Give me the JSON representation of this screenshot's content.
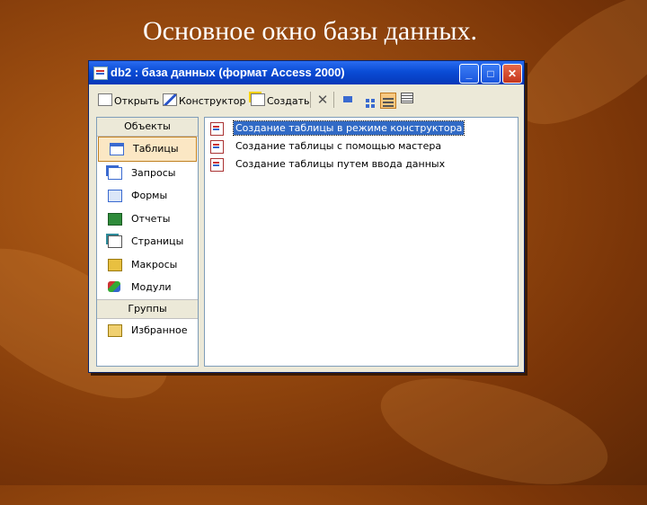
{
  "slide": {
    "title": "Основное окно базы данных."
  },
  "window": {
    "title": "db2 : база данных (формат Access 2000)",
    "controls": {
      "minimize": "_",
      "maximize": "□",
      "close": "✕"
    }
  },
  "toolbar": {
    "open": "Открыть",
    "design": "Конструктор",
    "create": "Создать"
  },
  "left_panel": {
    "objects_header": "Объекты",
    "items": [
      {
        "label": "Таблицы",
        "icon": "table-icon",
        "active": true
      },
      {
        "label": "Запросы",
        "icon": "query-icon"
      },
      {
        "label": "Формы",
        "icon": "form-icon"
      },
      {
        "label": "Отчеты",
        "icon": "report-icon"
      },
      {
        "label": "Страницы",
        "icon": "page-icon"
      },
      {
        "label": "Макросы",
        "icon": "macro-icon"
      },
      {
        "label": "Модули",
        "icon": "module-icon"
      }
    ],
    "groups_header": "Группы",
    "groups": [
      {
        "label": "Избранное",
        "icon": "favorites-folder-icon"
      }
    ]
  },
  "list": {
    "items": [
      {
        "label": "Создание таблицы в режиме конструктора",
        "selected": true
      },
      {
        "label": "Создание таблицы с помощью мастера"
      },
      {
        "label": "Создание таблицы путем ввода данных"
      }
    ]
  }
}
